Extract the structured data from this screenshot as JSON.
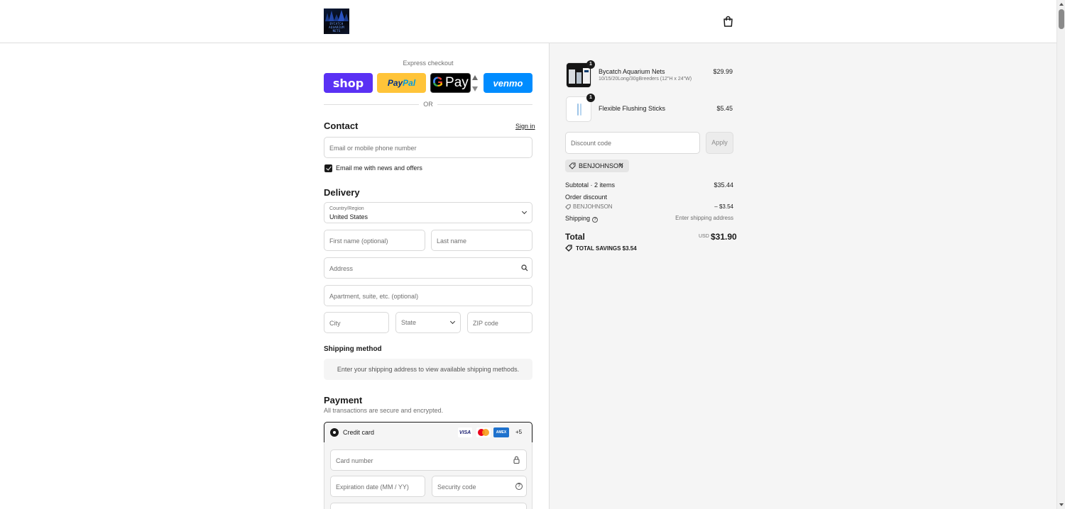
{
  "header": {
    "logo_text": [
      "BYCATCH",
      "AQUARIUM",
      "NETS"
    ]
  },
  "express": {
    "label": "Express checkout",
    "shop": "shop",
    "paypal_a": "Pay",
    "paypal_b": "Pal",
    "gpay_g": "G",
    "gpay": "Pay",
    "venmo": "venmo",
    "or": "OR"
  },
  "contact": {
    "title": "Contact",
    "sign_in": "Sign in",
    "email_placeholder": "Email or mobile phone number",
    "news_label": "Email me with news and offers",
    "news_checked": true
  },
  "delivery": {
    "title": "Delivery",
    "country_label": "Country/Region",
    "country_value": "United States",
    "first_name": "First name (optional)",
    "last_name": "Last name",
    "address": "Address",
    "apartment": "Apartment, suite, etc. (optional)",
    "city": "City",
    "state": "State",
    "zip": "ZIP code"
  },
  "shipping_method": {
    "title": "Shipping method",
    "message": "Enter your shipping address to view available shipping methods."
  },
  "payment": {
    "title": "Payment",
    "subtitle": "All transactions are secure and encrypted.",
    "credit_card": "Credit card",
    "visa": "VISA",
    "amex": "AMEX",
    "more": "+5",
    "card_number": "Card number",
    "expiration": "Expiration date (MM / YY)",
    "security_code": "Security code"
  },
  "summary": {
    "items": [
      {
        "qty": "1",
        "name": "Bycatch Aquarium Nets",
        "variant": "10/15/20Long/30gBreeders (12\"H x 24\"W)",
        "price": "$29.99"
      },
      {
        "qty": "1",
        "name": "Flexible Flushing Sticks",
        "variant": "",
        "price": "$5.45"
      }
    ],
    "discount_placeholder": "Discount code",
    "apply": "Apply",
    "applied_code": "BENJOHNSON",
    "remove": "×",
    "subtotal_label": "Subtotal · 2 items",
    "subtotal": "$35.44",
    "order_discount_label": "Order discount",
    "discount_code": "BENJOHNSON",
    "discount_amount": "– $3.54",
    "shipping_label": "Shipping",
    "shipping_value": "Enter shipping address",
    "total_label": "Total",
    "currency": "USD",
    "total": "$31.90",
    "savings": "TOTAL SAVINGS  $3.54"
  }
}
